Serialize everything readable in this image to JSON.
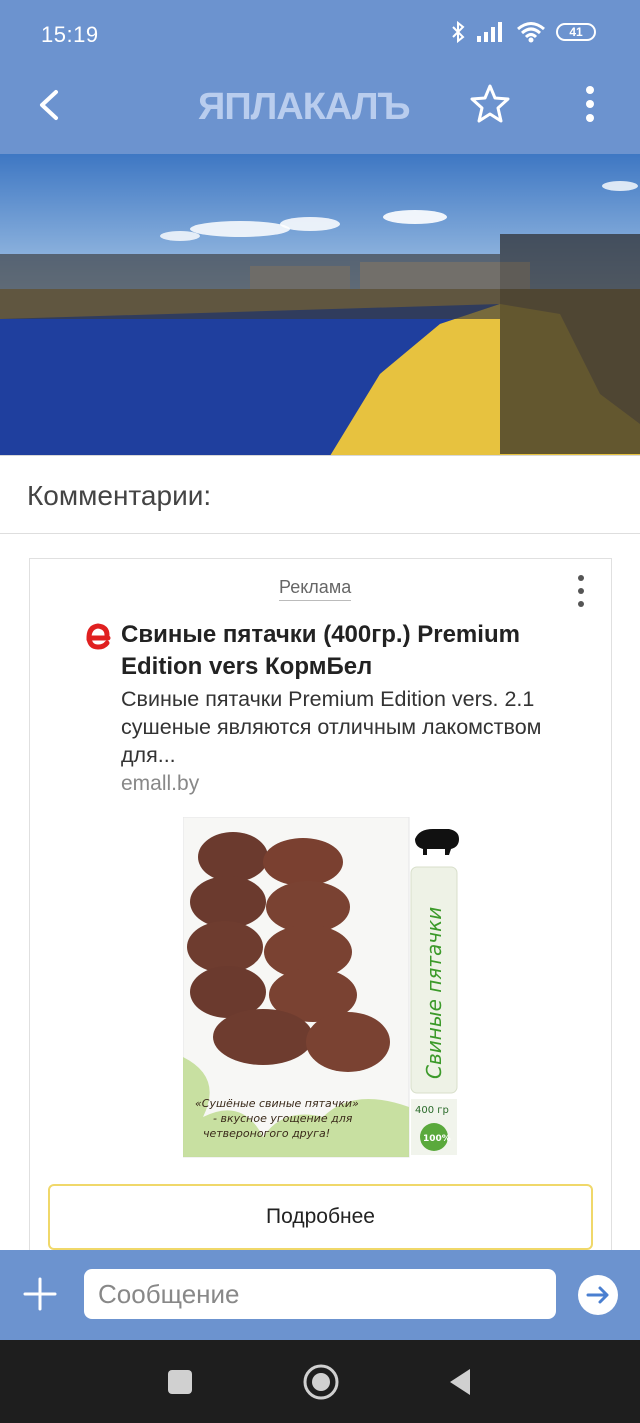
{
  "status_bar": {
    "time": "15:19",
    "battery": "41",
    "icons": [
      "bluetooth-icon",
      "signal-icon",
      "wifi-icon",
      "battery-icon"
    ]
  },
  "app_bar": {
    "logo_text": "ЯПЛАКАЛЪ",
    "icons": [
      "back-arrow-icon",
      "star-icon",
      "more-vert-icon"
    ]
  },
  "hero_image": {
    "description_icon": "photo-icon"
  },
  "comments": {
    "title": "Комментарии:"
  },
  "ad": {
    "label": "Реклама",
    "title": "Свиные пятачки (400гр.) Premium Edition vers КормБел",
    "description": "Свиные пятачки Premium Edition vers. 2.1 сушеные являются отличным лакомством для...",
    "domain": "emall.by",
    "button_label": "Подробнее",
    "product_image": {
      "vertical_text": "Свиные пятачки",
      "caption_lines": [
        "«Сушёные свиные пятачки»",
        "- вкусное угощение для",
        "четвероногого друга!"
      ],
      "weight": "400 гр",
      "badge": "100%"
    }
  },
  "composer": {
    "placeholder": "Сообщение"
  },
  "colors": {
    "app_bar": "#6c93cf",
    "nav_bar": "#1e1e1e",
    "ad_button_border": "#f0d86a"
  }
}
